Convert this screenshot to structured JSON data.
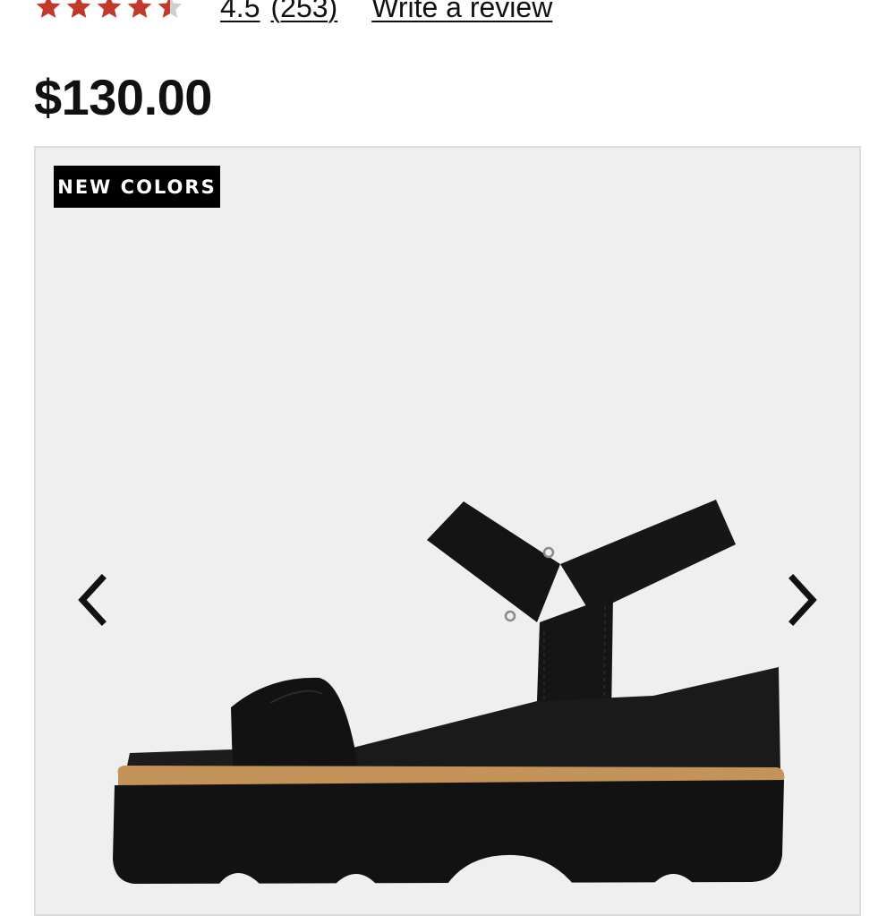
{
  "rating": {
    "value": "4.5",
    "count": "(253)",
    "write_review": "Write a review",
    "stars_filled": 4.5,
    "star_color": "#c0392b",
    "star_empty_color": "#cfcfcf"
  },
  "price": "$130.00",
  "gallery": {
    "badge": "NEW COLORS",
    "prev_icon": "chevron-left-icon",
    "next_icon": "chevron-right-icon",
    "background_color": "#efefef",
    "product_image_alt": "Black wedge platform sandal with ankle strap"
  }
}
